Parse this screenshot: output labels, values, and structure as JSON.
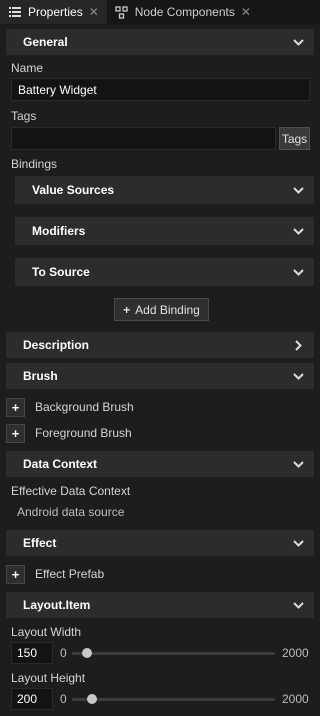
{
  "tabs": [
    {
      "label": "Properties",
      "icon": "list-icon",
      "active": true
    },
    {
      "label": "Node Components",
      "icon": "components-icon",
      "active": false
    }
  ],
  "sections": {
    "general": "General",
    "description": "Description",
    "brush": "Brush",
    "data_context": "Data Context",
    "effect": "Effect",
    "layout_item": "Layout.Item"
  },
  "general": {
    "name_label": "Name",
    "name_value": "Battery Widget",
    "tags_label": "Tags",
    "tags_value": "",
    "tags_button": "Tags",
    "bindings_label": "Bindings",
    "bindings": {
      "value_sources": "Value Sources",
      "modifiers": "Modifiers",
      "to_source": "To Source"
    },
    "add_binding": "Add Binding"
  },
  "brush": {
    "background": "Background Brush",
    "foreground": "Foreground Brush"
  },
  "data_context": {
    "label": "Effective Data Context",
    "value": "Android data source"
  },
  "effect": {
    "prefab": "Effect Prefab"
  },
  "layout": {
    "width_label": "Layout Width",
    "width_value": "150",
    "width_min": "0",
    "width_max": "2000",
    "width_fraction": 0.075,
    "height_label": "Layout Height",
    "height_value": "200",
    "height_min": "0",
    "height_max": "2000",
    "height_fraction": 0.1
  },
  "colors": {
    "background": "#1d1d1d",
    "header": "#2c2c2c",
    "field": "#131313"
  }
}
